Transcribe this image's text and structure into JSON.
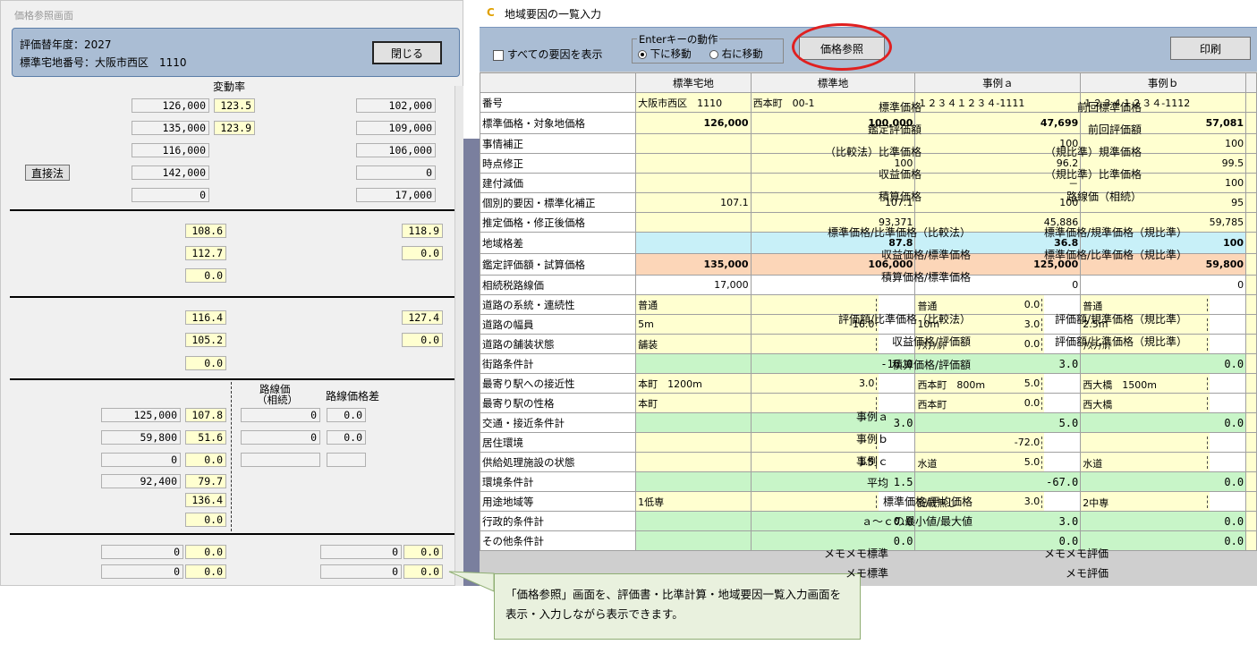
{
  "left": {
    "title": "価格参照画面",
    "year_label": "評価替年度：2027",
    "lot_label": "標準宅地番号：大阪市西区　1110",
    "close": "閉じる",
    "change_rate": "変動率",
    "s1": [
      {
        "label": "標準価格",
        "val": "126,000",
        "rate": "123.5",
        "label2": "前回標準価格",
        "val2": "102,000"
      },
      {
        "label": "鑑定評価額",
        "val": "135,000",
        "rate": "123.9",
        "label2": "前回評価額",
        "val2": "109,000"
      },
      {
        "label": "（比較法）比準価格",
        "val": "116,000",
        "rate": "",
        "label2": "（規比準）規準価格",
        "val2": "106,000"
      },
      {
        "label": "収益価格",
        "val": "142,000",
        "rate": "",
        "label2": "（規比準）比準価格",
        "val2": "0"
      },
      {
        "label": "積算価格",
        "val": "0",
        "rate": "",
        "label2": "路線価（相続）",
        "val2": "17,000"
      }
    ],
    "direct": "直接法",
    "s2": [
      {
        "label": "標準価格/比準価格（比較法）",
        "val": "108.6",
        "label2": "標準価格/規準価格（規比準）",
        "val2": "118.9"
      },
      {
        "label": "収益価格/標準価格",
        "val": "112.7",
        "label2": "標準価格/比準価格（規比準）",
        "val2": "0.0"
      },
      {
        "label": "積算価格/標準価格",
        "val": "0.0"
      }
    ],
    "s3": [
      {
        "label": "評価額/比準価格（比較法）",
        "val": "116.4",
        "label2": "評価額/規準価格（規比準）",
        "val2": "127.4"
      },
      {
        "label": "収益価格/評価額",
        "val": "105.2",
        "label2": "評価額/比準価格（規比準）",
        "val2": "0.0"
      },
      {
        "label": "積算価格/評価額",
        "val": "0.0"
      }
    ],
    "s4head": {
      "rosen": "路線価",
      "sozoku": "（相続）",
      "diff": "路線価格差"
    },
    "s4": [
      {
        "label": "事例ａ",
        "val": "125,000",
        "rate": "107.8",
        "rosen": "0",
        "diff": "0.0"
      },
      {
        "label": "事例ｂ",
        "val": "59,800",
        "rate": "51.6",
        "rosen": "0",
        "diff": "0.0"
      },
      {
        "label": "事例ｃ",
        "val": "0",
        "rate": "0.0",
        "rosen": "",
        "diff": ""
      },
      {
        "label": "平均",
        "val": "92,400",
        "rate": "79.7"
      }
    ],
    "avg_ratio_label": "標準価格/平均価格",
    "avg_ratio": "136.4",
    "minmax_label": "ａ～ｃの最小値/最大値",
    "minmax": "0.0",
    "memo": [
      {
        "label": "メモメモ標準",
        "val": "0",
        "rate": "0.0",
        "label2": "メモメモ評価",
        "val2": "0",
        "rate2": "0.0"
      },
      {
        "label": "メモ標準",
        "val": "0",
        "rate": "0.0",
        "label2": "メモ評価",
        "val2": "0",
        "rate2": "0.0"
      }
    ]
  },
  "right": {
    "title": "地域要因の一覧入力",
    "show_all": "すべての要因を表示",
    "enter_label": "Enterキーの動作",
    "down": "下に移動",
    "right": "右に移動",
    "price_ref": "価格参照",
    "print": "印刷",
    "cols": [
      "標準宅地",
      "標準地",
      "事例ａ",
      "事例ｂ"
    ],
    "rows": [
      {
        "label": "番号",
        "cells": [
          {
            "t": "大阪市西区　1110",
            "cl": "y"
          },
          {
            "t": "西本町　00-1",
            "cl": "y"
          },
          {
            "t": "１２３４１２３４-1111",
            "cl": "y"
          },
          {
            "t": "１２３４１２３４-1112",
            "cl": "y"
          }
        ]
      },
      {
        "label": "標準価格・対象地価格",
        "cells": [
          {
            "t": "126,000",
            "cl": "y r b"
          },
          {
            "t": "100,000",
            "cl": "y r b"
          },
          {
            "t": "47,699",
            "cl": "y r b"
          },
          {
            "t": "57,081",
            "cl": "y r b"
          }
        ]
      },
      {
        "label": "事情補正",
        "cells": [
          {
            "t": "",
            "cl": "y"
          },
          {
            "t": "",
            "cl": "y"
          },
          {
            "t": "100",
            "cl": "y r"
          },
          {
            "t": "100",
            "cl": "y r"
          }
        ]
      },
      {
        "label": "時点修正",
        "cells": [
          {
            "t": "",
            "cl": "y"
          },
          {
            "t": "100",
            "cl": "y r"
          },
          {
            "t": "96.2",
            "cl": "y r"
          },
          {
            "t": "99.5",
            "cl": "y r"
          }
        ]
      },
      {
        "label": "建付減価",
        "cells": [
          {
            "t": "",
            "cl": "y"
          },
          {
            "t": "",
            "cl": "y"
          },
          {
            "t": "－",
            "cl": "y r"
          },
          {
            "t": "100",
            "cl": "y r"
          }
        ]
      },
      {
        "label": "個別的要因・標準化補正",
        "cells": [
          {
            "t": "107.1",
            "cl": "y r"
          },
          {
            "t": "107.1",
            "cl": "y r"
          },
          {
            "t": "100",
            "cl": "y r"
          },
          {
            "t": "95",
            "cl": "y r"
          }
        ]
      },
      {
        "label": "推定価格・修正後価格",
        "cells": [
          {
            "t": "",
            "cl": "y"
          },
          {
            "t": "93,371",
            "cl": "y r"
          },
          {
            "t": "45,886",
            "cl": "y r"
          },
          {
            "t": "59,785",
            "cl": "y r"
          }
        ]
      },
      {
        "label": "地域格差",
        "cells": [
          {
            "t": "",
            "cl": "c"
          },
          {
            "t": "87.8",
            "cl": "c r b"
          },
          {
            "t": "36.8",
            "cl": "c r b"
          },
          {
            "t": "100",
            "cl": "c r b"
          }
        ]
      },
      {
        "label": "鑑定評価額・試算価格",
        "cells": [
          {
            "t": "135,000",
            "cl": "p r b"
          },
          {
            "t": "106,000",
            "cl": "p r b"
          },
          {
            "t": "125,000",
            "cl": "p r b"
          },
          {
            "t": "59,800",
            "cl": "p r b"
          }
        ]
      },
      {
        "label": "相続税路線価",
        "cells": [
          {
            "t": "17,000",
            "cl": "w r"
          },
          {
            "t": "",
            "cl": "w"
          },
          {
            "t": "0",
            "cl": "w r"
          },
          {
            "t": "0",
            "cl": "w r"
          }
        ]
      }
    ],
    "rows2": [
      {
        "label": "道路の系統・連続性",
        "a": "普通",
        "b": "",
        "bv": "",
        "c": "普通",
        "cv": "0.0",
        "d": "普通",
        "dv": "",
        "tot": false
      },
      {
        "label": "道路の幅員",
        "a": "5m",
        "b": "",
        "bv": "-16.0",
        "c": "10m",
        "cv": "3.0",
        "d": "2.5m",
        "dv": "",
        "tot": false
      },
      {
        "label": "道路の舗装状態",
        "a": "舗装",
        "b": "",
        "bv": "",
        "c": "ｱｽﾌｧﾙﾄ",
        "cv": "0.0",
        "d": "ｱｽﾌｧﾙﾄ",
        "dv": "",
        "tot": false
      },
      {
        "label": "街路条件計",
        "b": "-16.0",
        "c": "3.0",
        "d": "0.0",
        "tot": true
      },
      {
        "label": "最寄り駅への接近性",
        "a": "本町　1200m",
        "b": "",
        "bv": "3.0",
        "c": "西本町　800m",
        "cv": "5.0",
        "d": "西大橋　1500m",
        "dv": "",
        "tot": false
      },
      {
        "label": "最寄り駅の性格",
        "a": "本町",
        "b": "",
        "bv": "",
        "c": "西本町",
        "cv": "0.0",
        "d": "西大橋",
        "dv": "",
        "tot": false
      },
      {
        "label": "交通・接近条件計",
        "b": "3.0",
        "c": "5.0",
        "d": "0.0",
        "tot": true
      },
      {
        "label": "居住環境",
        "a": "",
        "b": "",
        "bv": "",
        "c": "",
        "cv": "-72.0",
        "d": "",
        "dv": "",
        "tot": false
      },
      {
        "label": "供給処理施設の状態",
        "a": "",
        "b": "",
        "bv": "1.5",
        "c": "水道",
        "cv": "5.0",
        "d": "水道",
        "dv": "",
        "tot": false
      },
      {
        "label": "環境条件計",
        "b": "1.5",
        "c": "-67.0",
        "d": "0.0",
        "tot": true
      },
      {
        "label": "用途地域等",
        "a": "1低専",
        "b": "",
        "bv": "",
        "c": "記載無し",
        "cv": "3.0",
        "d": "2中専",
        "dv": "",
        "tot": false
      },
      {
        "label": "行政的条件計",
        "b": "0.0",
        "c": "3.0",
        "d": "0.0",
        "tot": true
      },
      {
        "label": "その他条件計",
        "b": "0.0",
        "c": "0.0",
        "d": "0.0",
        "tot": true
      }
    ]
  },
  "tooltip": {
    "line1": "「価格参照」画面を、評価書・比準計算・地域要因一覧入力画面を",
    "line2": "表示・入力しながら表示できます。"
  }
}
